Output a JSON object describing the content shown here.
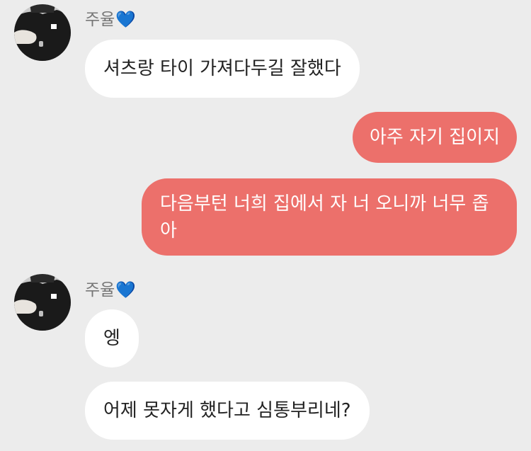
{
  "messages": [
    {
      "type": "sender",
      "name": "주율",
      "heart": "💙"
    },
    {
      "type": "incoming",
      "text": "셔츠랑 타이 가져다두길 잘했다"
    },
    {
      "type": "outgoing",
      "text": "아주 자기 집이지"
    },
    {
      "type": "outgoing",
      "text": "다음부턴 너희 집에서 자 너 오니까 너무 좁아"
    },
    {
      "type": "sender",
      "name": "주율",
      "heart": "💙"
    },
    {
      "type": "incoming",
      "text": "엥"
    },
    {
      "type": "incoming",
      "text": "어제 못자게 했다고 심통부리네?"
    }
  ],
  "avatar_icon": "profile-photo",
  "colors": {
    "background": "#ececec",
    "incoming_bubble": "#ffffff",
    "outgoing_bubble": "#ec706b",
    "sender_name": "#777777"
  }
}
